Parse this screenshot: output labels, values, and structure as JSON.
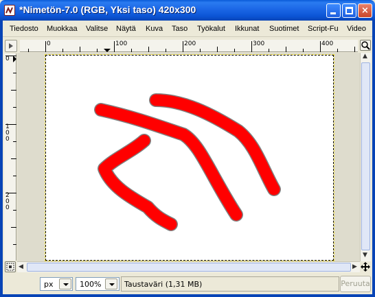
{
  "window": {
    "title": "*Nimetön-7.0 (RGB, Yksi taso) 420x300",
    "app_icon": "gimp-wilber-icon",
    "controls": {
      "minimize": "minimize-icon",
      "maximize": "maximize-icon",
      "close": "×"
    }
  },
  "menubar": {
    "items": [
      {
        "label": "Tiedosto"
      },
      {
        "label": "Muokkaa"
      },
      {
        "label": "Valitse"
      },
      {
        "label": "Näytä"
      },
      {
        "label": "Kuva"
      },
      {
        "label": "Taso"
      },
      {
        "label": "Työkalut"
      },
      {
        "label": "Ikkunat"
      },
      {
        "label": "Suotimet"
      },
      {
        "label": "Script-Fu"
      },
      {
        "label": "Video"
      }
    ]
  },
  "rulers": {
    "horizontal_labels": [
      "0",
      "100",
      "200",
      "300",
      "400"
    ],
    "vertical_labels": [
      "0",
      "100",
      "200"
    ]
  },
  "canvas": {
    "width": 420,
    "height": 300,
    "background": "#ffffff",
    "stroke_color": "#ff0000",
    "selection_outline": "dashed-yellow-black"
  },
  "statusbar": {
    "unit": "px",
    "zoom": "100%",
    "message": "Taustaväri (1,31 MB)",
    "cancel_label": "Peruuta"
  },
  "icons": {
    "menu_arrow": "menu-arrow-icon",
    "zoom": "zoom-icon",
    "navigate": "navigate-icon",
    "move": "move-icon"
  }
}
